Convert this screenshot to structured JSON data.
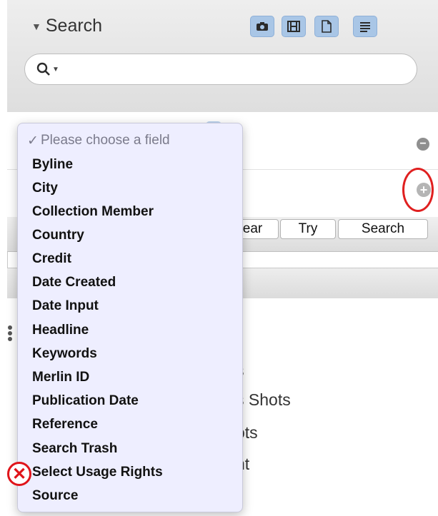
{
  "header": {
    "title": "Search",
    "tools": [
      "camera-icon",
      "film-icon",
      "document-icon",
      "list-icon"
    ]
  },
  "search": {
    "placeholder": ""
  },
  "buttons": {
    "clear_fragment": "ear",
    "try": "Try",
    "search": "Search"
  },
  "dropdown": {
    "selected": "Please choose a field",
    "items": [
      "Byline",
      "City",
      "Collection Member",
      "Country",
      "Credit",
      "Date Created",
      "Date Input",
      "Headline",
      "Keywords",
      "Merlin ID",
      "Publication Date",
      "Reference",
      "Search Trash",
      "Select Usage Rights",
      "Source"
    ]
  },
  "results_fragments": [
    "s",
    "s Shots",
    "ots",
    "nt"
  ],
  "colors": {
    "accent_ring": "#e02020",
    "tool_blue": "#a9c6e6",
    "dropdown_bg": "#eeeeff"
  }
}
